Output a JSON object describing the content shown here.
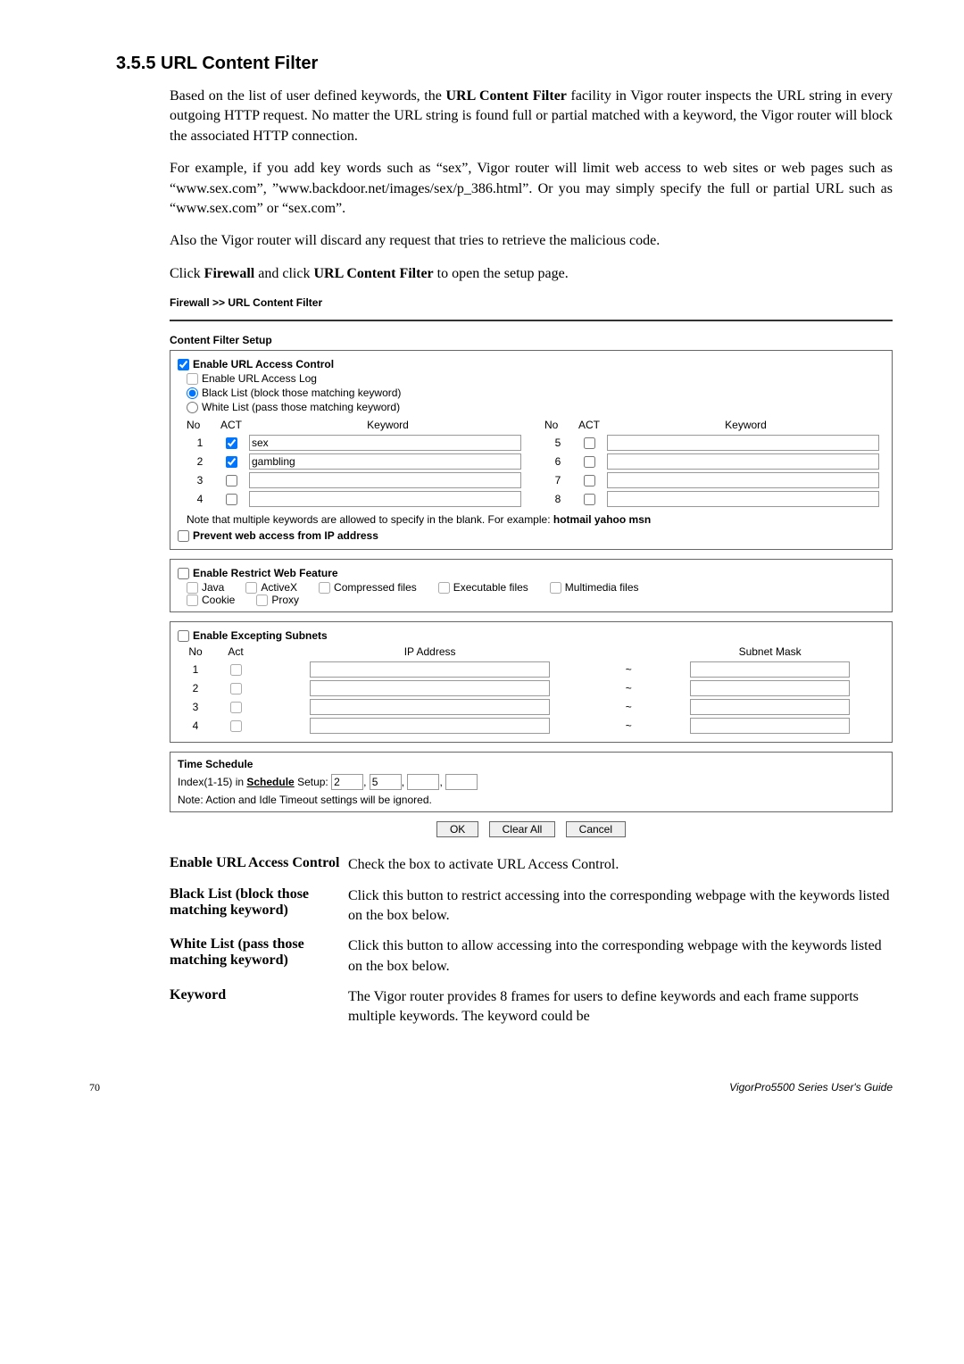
{
  "section": {
    "title": "3.5.5 URL Content Filter",
    "para1_a": "Based on the list of user defined keywords, the ",
    "para1_b": "URL Content Filter",
    "para1_c": " facility in Vigor router inspects the URL string in every outgoing HTTP request. No matter the URL string is found full or partial matched with a keyword, the Vigor router will block the associated HTTP connection.",
    "para2": "For example, if you add key words such as “sex”, Vigor router will limit web access to web sites or web pages such as “www.sex.com”, ”www.backdoor.net/images/sex/p_386.html”. Or you may simply specify the full or partial URL such as “www.sex.com” or “sex.com”.",
    "para3": "Also the Vigor router will discard any request that tries to retrieve the malicious code.",
    "para4_a": "Click ",
    "para4_b": "Firewall",
    "para4_c": " and click ",
    "para4_d": "URL Content Filter",
    "para4_e": " to open the setup page."
  },
  "ui": {
    "breadcrumb": "Firewall >> URL Content Filter",
    "panel_title": "Content Filter Setup",
    "enable_access": "Enable URL Access Control",
    "enable_log": "Enable URL Access Log",
    "blacklist": "Black List (block those matching keyword)",
    "whitelist": "White List (pass those matching keyword)",
    "col_no": "No",
    "col_act": "ACT",
    "col_keyword": "Keyword",
    "keywords_left": [
      {
        "no": "1",
        "checked": true,
        "value": "sex"
      },
      {
        "no": "2",
        "checked": true,
        "value": "gambling"
      },
      {
        "no": "3",
        "checked": false,
        "value": ""
      },
      {
        "no": "4",
        "checked": false,
        "value": ""
      }
    ],
    "keywords_right": [
      {
        "no": "5",
        "checked": false,
        "value": ""
      },
      {
        "no": "6",
        "checked": false,
        "value": ""
      },
      {
        "no": "7",
        "checked": false,
        "value": ""
      },
      {
        "no": "8",
        "checked": false,
        "value": ""
      }
    ],
    "note_pre": "Note that multiple keywords are allowed to specify in the blank. For example: ",
    "note_bold": "hotmail yahoo msn",
    "prevent_ip": "Prevent web access from IP address",
    "restrict_head": "Enable Restrict Web Feature",
    "features_row1": [
      "Java",
      "ActiveX",
      "Compressed files",
      "Executable files",
      "Multimedia files"
    ],
    "features_row2": [
      "Cookie",
      "Proxy"
    ],
    "excepting_head": "Enable Excepting Subnets",
    "subnet_cols": {
      "no": "No",
      "act": "Act",
      "ip": "IP Address",
      "tilde": "~",
      "mask": "Subnet Mask"
    },
    "subnet_rows": [
      "1",
      "2",
      "3",
      "4"
    ],
    "time_head": "Time Schedule",
    "sched_label_pre": "Index(1-15) in ",
    "sched_link": "Schedule",
    "sched_label_post": " Setup: ",
    "sched_vals": [
      "2",
      "5",
      "",
      ""
    ],
    "sched_note": "Note: Action and Idle Timeout settings will be ignored.",
    "btn_ok": "OK",
    "btn_clear": "Clear All",
    "btn_cancel": "Cancel"
  },
  "defs": [
    {
      "term": "Enable URL Access Control",
      "desc": "Check the box to activate URL Access Control."
    },
    {
      "term": "Black List (block those matching keyword)",
      "desc": "Click this button to restrict accessing into the corresponding webpage with the keywords listed on the box below."
    },
    {
      "term": "White List (pass those matching keyword)",
      "desc": "Click this button to allow accessing into the corresponding webpage with the keywords listed on the box below."
    },
    {
      "term": "Keyword",
      "desc": "The Vigor router provides 8 frames for users to define keywords and each frame supports multiple keywords. The keyword could be"
    }
  ],
  "footer": {
    "page": "70",
    "guide": "VigorPro5500  Series  User's Guide"
  }
}
